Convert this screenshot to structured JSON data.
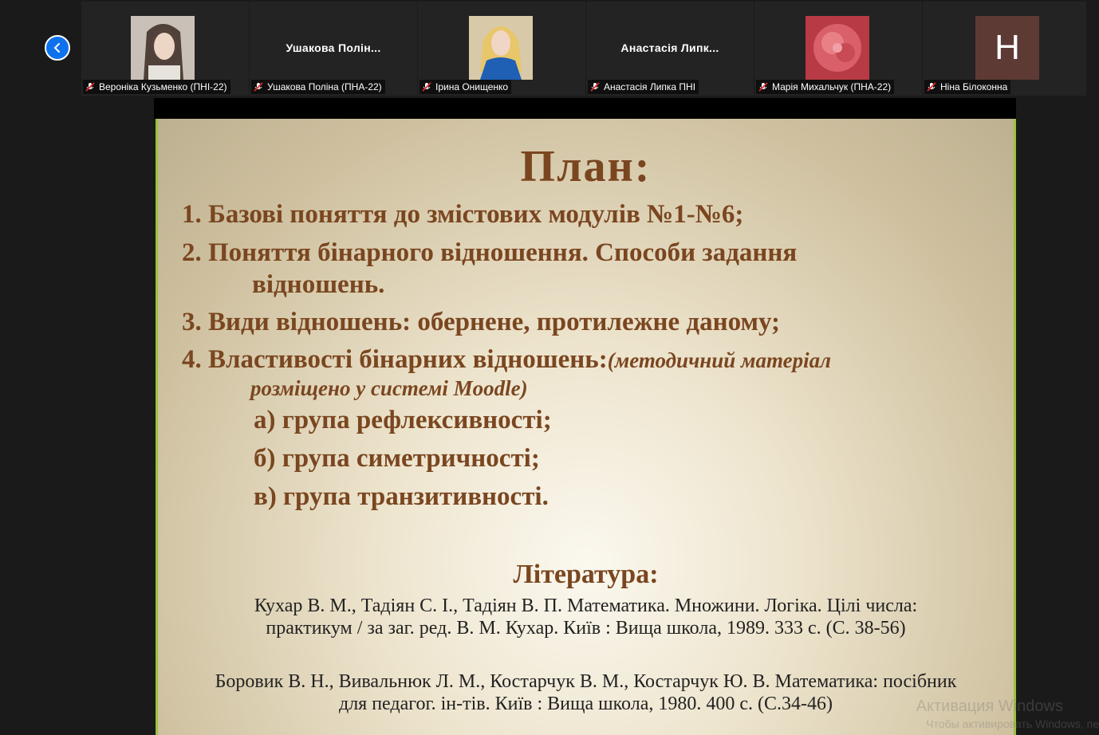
{
  "participants": [
    {
      "label": "Вероніка Кузьменко (ПНІ-22)",
      "type": "photo-girl"
    },
    {
      "label": "Ушакова Поліна (ПНА-22)",
      "display_name": "Ушакова  Полін...",
      "type": "name"
    },
    {
      "label": "Ірина Онищенко",
      "type": "photo-woman"
    },
    {
      "label": "Анастасія Липка ПНІ",
      "display_name": "Анастасія  Липк...",
      "type": "name"
    },
    {
      "label": "Марія Михальчук (ПНА-22)",
      "type": "photo-flower"
    },
    {
      "label": "Ніна Білоконна",
      "initial": "Н",
      "type": "initial"
    }
  ],
  "slide": {
    "title": "План:",
    "items": [
      {
        "num": "1. ",
        "text": "Базові поняття до змістових модулів №1-№6;"
      },
      {
        "num": "2. ",
        "text": "Поняття бінарного відношення. Способи задання",
        "cont": "відношень."
      },
      {
        "num": "3. ",
        "text": "Види відношень: обернене, протилежне даному;"
      },
      {
        "num": "4. ",
        "text": "Властивості бінарних відношень:",
        "note": "(методичний матеріал",
        "note2": "розміщено у системі Moodle)"
      }
    ],
    "subitems": [
      "а) група рефлексивності;",
      "б) група симетричності;",
      "в) група транзитивності."
    ],
    "literature_title": "Література:",
    "ref1_line1": "Кухар В. М., Тадіян С. І., Тадіян В. П. Математика. Множини. Логіка. Цілі числа:",
    "ref1_line2": "практикум / за заг. ред. В. М. Кухар. Київ : Вища школа, 1989. 333 с. (С. 38-56)",
    "ref2_line1": "Боровик В. Н., Вивальнюк Л. М., Костарчук В. М., Костарчук Ю. В. Математика: посібник",
    "ref2_line2": "для педагог. ін-тів. Київ : Вища школа, 1980. 400 с. (С.34-46)"
  },
  "watermark": {
    "line1": "Активация Windows",
    "line2": "Чтобы активировать Windows, пе"
  },
  "colors": {
    "accent": "#0e72ed",
    "slide_text": "#7a4620",
    "border": "#9bc23d"
  }
}
